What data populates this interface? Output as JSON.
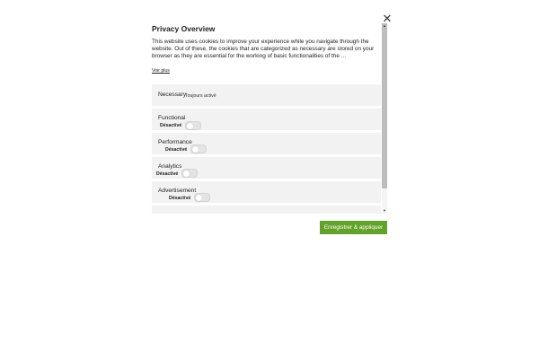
{
  "dialog": {
    "title": "Privacy Overview",
    "close_symbol": "✕",
    "description": "This website uses cookies to improve your experience while you navigate through the website. Out of these, the cookies that are categorized as necessary are stored on your browser as they are essential for the working of basic functionalities of the ...",
    "show_more_label": "Voir plus",
    "categories": [
      {
        "label": "Necessary",
        "status": "Toujours activé"
      },
      {
        "label": "Functional",
        "status": "Désactivé",
        "enabled": false
      },
      {
        "label": "Performance",
        "status": "Désactivé",
        "enabled": false
      },
      {
        "label": "Analytics",
        "status": "Désactivé",
        "enabled": false
      },
      {
        "label": "Advertisement",
        "status": "Désactivé",
        "enabled": false
      }
    ],
    "save_button_label": "Enregistrer & appliquer"
  },
  "icons": {
    "close": "close-icon",
    "scroll_up": "chevron-up-icon",
    "scroll_down": "chevron-down-icon"
  },
  "colors": {
    "save_button": "#61a229",
    "category_bg": "#f2f2f2",
    "toggle_off": "#e4e4e4"
  }
}
